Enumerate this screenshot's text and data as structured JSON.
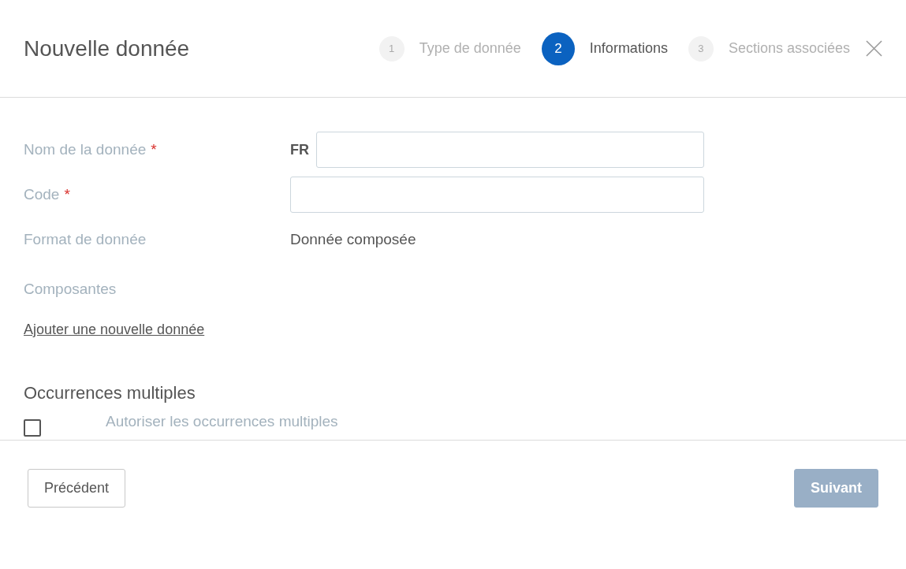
{
  "dialog": {
    "title": "Nouvelle donnée"
  },
  "steps": [
    {
      "number": "1",
      "label": "Type de donnée",
      "selected": false
    },
    {
      "number": "2",
      "label": "Informations",
      "selected": true
    },
    {
      "number": "3",
      "label": "Sections associées",
      "selected": false
    }
  ],
  "fields": [
    {
      "kind": "input",
      "label": "Nom de la donnée",
      "required_mark": "*",
      "prefix": "FR"
    },
    {
      "kind": "input",
      "label": "Code",
      "required_mark": "*"
    },
    {
      "kind": "text",
      "label": "Format de donnée",
      "value": "Donnée composée"
    },
    {
      "kind": "empty",
      "label": "Composantes"
    }
  ],
  "add_link": "Ajouter une nouvelle donnée",
  "occurrences": {
    "heading": "Occurrences multiples",
    "checkbox_label": "Autoriser les occurrences multiples",
    "checked": false
  },
  "buttons": {
    "previous": {
      "label": "Précédent",
      "disabled": false
    },
    "next": {
      "label": "Suivant",
      "disabled": true
    }
  }
}
